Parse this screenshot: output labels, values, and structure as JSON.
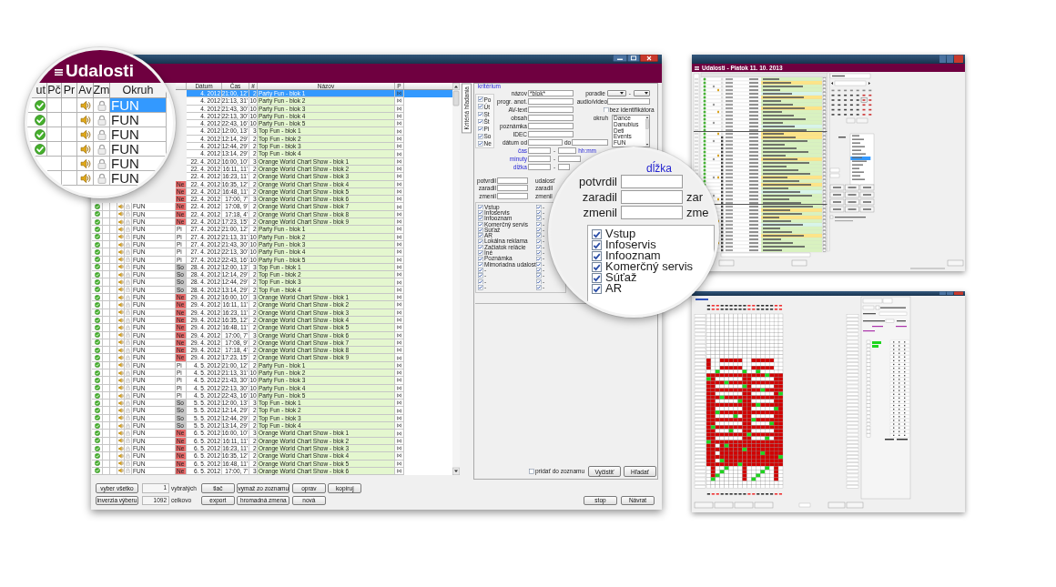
{
  "main_window": {
    "magnifier": {
      "title": "Udalosti",
      "columns": [
        "ut",
        "Pč",
        "Pr",
        "Av",
        "Zm",
        "Okruh"
      ],
      "rows": [
        {
          "selected": true,
          "confirmed": true,
          "audio": true,
          "locked": true,
          "okruh": "FUN"
        },
        {
          "selected": false,
          "confirmed": true,
          "audio": true,
          "locked": true,
          "okruh": "FUN"
        },
        {
          "selected": false,
          "confirmed": true,
          "audio": true,
          "locked": true,
          "okruh": "FUN"
        },
        {
          "selected": false,
          "confirmed": true,
          "audio": true,
          "locked": true,
          "okruh": "FUN"
        },
        {
          "selected": false,
          "audio": true,
          "locked": true,
          "okruh": "FUN"
        },
        {
          "selected": false,
          "audio": true,
          "locked": true,
          "okruh": "FUN"
        }
      ]
    },
    "table": {
      "columns": [
        "Dátum",
        "Čas",
        "#",
        "Názov",
        "P"
      ],
      "rows": [
        {
          "selected": true,
          "date": "4. 2012",
          "time": "21:00, 12'",
          "count": "2",
          "name": "Party Fun - blok 1"
        },
        {
          "selected": false,
          "date": "4. 2012",
          "time": "21:13, 31'",
          "count": "10",
          "name": "Party Fun - blok 2"
        },
        {
          "selected": false,
          "date": "4. 2012",
          "time": "21:43, 30'",
          "count": "10",
          "name": "Party Fun - blok 3"
        },
        {
          "selected": false,
          "date": "4. 2012",
          "time": "22:13, 30'",
          "count": "10",
          "name": "Party Fun - blok 4"
        },
        {
          "selected": false,
          "date": "4. 2012",
          "time": "22:43, 16'",
          "count": "10",
          "name": "Party Fun - blok 5"
        },
        {
          "selected": false,
          "date": "4. 2012",
          "time": "12:00, 13'",
          "count": "3",
          "name": "Top Fun - blok 1"
        },
        {
          "selected": false,
          "date": "4. 2012",
          "time": "12:14, 29'",
          "count": "2",
          "name": "Top Fun - blok 2"
        },
        {
          "selected": false,
          "date": "4. 2012",
          "time": "12:44, 29'",
          "count": "2",
          "name": "Top Fun - blok 3"
        },
        {
          "selected": false,
          "date": "4. 2012",
          "time": "13:14, 29'",
          "count": "2",
          "name": "Top Fun - blok 4"
        },
        {
          "selected": false,
          "date": "22. 4. 2012",
          "time": "16:00, 10'",
          "count": "3",
          "name": "Orange World Chart Show - blok 1"
        },
        {
          "selected": false,
          "date": "22. 4. 2012",
          "time": "16:11, 11'",
          "count": "2",
          "name": "Orange World Chart Show - blok 2"
        },
        {
          "selected": false,
          "date": "22. 4. 2012",
          "time": "16:23, 11'",
          "count": "2",
          "name": "Orange World Chart Show - blok 3"
        },
        {
          "selected": false,
          "day": "Ne",
          "color": "#e86a6a",
          "date": "22. 4. 2012",
          "time": "16:35, 12'",
          "count": "2",
          "name": "Orange World Chart Show - blok 4"
        },
        {
          "selected": false,
          "day": "Ne",
          "color": "#e86a6a",
          "date": "22. 4. 2012",
          "time": "16:48, 11'",
          "count": "2",
          "name": "Orange World Chart Show - blok 5"
        },
        {
          "selected": false,
          "day": "Ne",
          "color": "#e86a6a",
          "date": "22. 4. 2012",
          "time": "17:00, 7'",
          "count": "3",
          "name": "Orange World Chart Show - blok 6"
        },
        {
          "selected": false,
          "confirmed": true,
          "audio": true,
          "locked": true,
          "okruh": "FUN",
          "day": "Ne",
          "color": "#e86a6a",
          "date": "22. 4. 2012",
          "time": "17:08, 9'",
          "count": "2",
          "name": "Orange World Chart Show - blok 7"
        },
        {
          "selected": false,
          "confirmed": true,
          "audio": true,
          "locked": true,
          "okruh": "FUN",
          "day": "Ne",
          "color": "#e86a6a",
          "date": "22. 4. 2012",
          "time": "17:18, 4'",
          "count": "2",
          "name": "Orange World Chart Show - blok 8"
        },
        {
          "selected": false,
          "confirmed": true,
          "audio": true,
          "locked": true,
          "okruh": "FUN",
          "day": "Ne",
          "color": "#e86a6a",
          "date": "22. 4. 2012",
          "time": "17:23, 15'",
          "count": "2",
          "name": "Orange World Chart Show - blok 9"
        },
        {
          "selected": false,
          "confirmed": true,
          "audio": true,
          "locked": true,
          "okruh": "FUN",
          "day": "Pi",
          "date": "27. 4. 2012",
          "time": "21:00, 12'",
          "count": "2",
          "name": "Party Fun - blok 1"
        },
        {
          "selected": false,
          "confirmed": true,
          "audio": true,
          "locked": true,
          "okruh": "FUN",
          "day": "Pi",
          "date": "27. 4. 2012",
          "time": "21:13, 31'",
          "count": "10",
          "name": "Party Fun - blok 2"
        },
        {
          "selected": false,
          "confirmed": true,
          "audio": true,
          "locked": true,
          "okruh": "FUN",
          "day": "Pi",
          "date": "27. 4. 2012",
          "time": "21:43, 30'",
          "count": "10",
          "name": "Party Fun - blok 3"
        },
        {
          "selected": false,
          "confirmed": true,
          "audio": true,
          "locked": true,
          "okruh": "FUN",
          "day": "Pi",
          "date": "27. 4. 2012",
          "time": "22:13, 30'",
          "count": "10",
          "name": "Party Fun - blok 4"
        },
        {
          "selected": false,
          "confirmed": true,
          "audio": true,
          "locked": true,
          "okruh": "FUN",
          "day": "Pi",
          "date": "27. 4. 2012",
          "time": "22:43, 16'",
          "count": "10",
          "name": "Party Fun - blok 5"
        },
        {
          "selected": false,
          "confirmed": true,
          "audio": true,
          "locked": true,
          "okruh": "FUN",
          "day": "So",
          "color": "#c8c8c8",
          "date": "28. 4. 2012",
          "time": "12:00, 13'",
          "count": "3",
          "name": "Top Fun - blok 1"
        },
        {
          "selected": false,
          "confirmed": true,
          "audio": true,
          "locked": true,
          "okruh": "FUN",
          "day": "So",
          "color": "#c8c8c8",
          "date": "28. 4. 2012",
          "time": "12:14, 29'",
          "count": "2",
          "name": "Top Fun - blok 2"
        },
        {
          "selected": false,
          "confirmed": true,
          "audio": true,
          "locked": true,
          "okruh": "FUN",
          "day": "So",
          "color": "#c8c8c8",
          "date": "28. 4. 2012",
          "time": "12:44, 29'",
          "count": "2",
          "name": "Top Fun - blok 3"
        },
        {
          "selected": false,
          "confirmed": true,
          "audio": true,
          "locked": true,
          "okruh": "FUN",
          "day": "So",
          "color": "#c8c8c8",
          "date": "28. 4. 2012",
          "time": "13:14, 29'",
          "count": "2",
          "name": "Top Fun - blok 4"
        },
        {
          "selected": false,
          "confirmed": true,
          "audio": true,
          "locked": true,
          "okruh": "FUN",
          "day": "Ne",
          "color": "#e86a6a",
          "date": "29. 4. 2012",
          "time": "16:00, 10'",
          "count": "3",
          "name": "Orange World Chart Show - blok 1"
        },
        {
          "selected": false,
          "confirmed": true,
          "audio": true,
          "locked": true,
          "okruh": "FUN",
          "day": "Ne",
          "color": "#e86a6a",
          "date": "29. 4. 2012",
          "time": "16:11, 11'",
          "count": "2",
          "name": "Orange World Chart Show - blok 2"
        },
        {
          "selected": false,
          "confirmed": true,
          "audio": true,
          "locked": true,
          "okruh": "FUN",
          "day": "Ne",
          "color": "#e86a6a",
          "date": "29. 4. 2012",
          "time": "16:23, 11'",
          "count": "2",
          "name": "Orange World Chart Show - blok 3"
        },
        {
          "selected": false,
          "confirmed": true,
          "audio": true,
          "locked": true,
          "okruh": "FUN",
          "day": "Ne",
          "color": "#e86a6a",
          "date": "29. 4. 2012",
          "time": "16:35, 12'",
          "count": "2",
          "name": "Orange World Chart Show - blok 4"
        },
        {
          "selected": false,
          "confirmed": true,
          "audio": true,
          "locked": true,
          "okruh": "FUN",
          "day": "Ne",
          "color": "#e86a6a",
          "date": "29. 4. 2012",
          "time": "16:48, 11'",
          "count": "2",
          "name": "Orange World Chart Show - blok 5"
        },
        {
          "selected": false,
          "confirmed": true,
          "audio": true,
          "locked": true,
          "okruh": "FUN",
          "day": "Ne",
          "color": "#e86a6a",
          "date": "29. 4. 2012",
          "time": "17:00, 7'",
          "count": "3",
          "name": "Orange World Chart Show - blok 6"
        },
        {
          "selected": false,
          "confirmed": true,
          "audio": true,
          "locked": true,
          "okruh": "FUN",
          "day": "Ne",
          "color": "#e86a6a",
          "date": "29. 4. 2012",
          "time": "17:08, 9'",
          "count": "2",
          "name": "Orange World Chart Show - blok 7"
        },
        {
          "selected": false,
          "confirmed": true,
          "audio": true,
          "locked": true,
          "okruh": "FUN",
          "day": "Ne",
          "color": "#e86a6a",
          "date": "29. 4. 2012",
          "time": "17:18, 4'",
          "count": "2",
          "name": "Orange World Chart Show - blok 8"
        },
        {
          "selected": false,
          "confirmed": true,
          "audio": true,
          "locked": true,
          "okruh": "FUN",
          "day": "Ne",
          "color": "#e86a6a",
          "date": "29. 4. 2012",
          "time": "17:23, 15'",
          "count": "2",
          "name": "Orange World Chart Show - blok 9"
        },
        {
          "selected": false,
          "confirmed": true,
          "audio": true,
          "locked": true,
          "okruh": "FUN",
          "day": "Pi",
          "date": "4. 5. 2012",
          "time": "21:00, 12'",
          "count": "2",
          "name": "Party Fun - blok 1"
        },
        {
          "selected": false,
          "confirmed": true,
          "audio": true,
          "locked": true,
          "okruh": "FUN",
          "day": "Pi",
          "date": "4. 5. 2012",
          "time": "21:13, 31'",
          "count": "10",
          "name": "Party Fun - blok 2"
        },
        {
          "selected": false,
          "confirmed": true,
          "audio": true,
          "locked": true,
          "okruh": "FUN",
          "day": "Pi",
          "date": "4. 5. 2012",
          "time": "21:43, 30'",
          "count": "10",
          "name": "Party Fun - blok 3"
        },
        {
          "selected": false,
          "confirmed": true,
          "audio": true,
          "locked": true,
          "okruh": "FUN",
          "day": "Pi",
          "date": "4. 5. 2012",
          "time": "22:13, 30'",
          "count": "10",
          "name": "Party Fun - blok 4"
        },
        {
          "selected": false,
          "confirmed": true,
          "audio": true,
          "locked": true,
          "okruh": "FUN",
          "day": "Pi",
          "date": "4. 5. 2012",
          "time": "22:43, 16'",
          "count": "10",
          "name": "Party Fun - blok 5"
        },
        {
          "selected": false,
          "confirmed": true,
          "audio": true,
          "locked": true,
          "okruh": "FUN",
          "day": "So",
          "color": "#c8c8c8",
          "date": "5. 5. 2012",
          "time": "12:00, 13'",
          "count": "3",
          "name": "Top Fun - blok 1"
        },
        {
          "selected": false,
          "confirmed": true,
          "audio": true,
          "locked": true,
          "okruh": "FUN",
          "day": "So",
          "color": "#c8c8c8",
          "date": "5. 5. 2012",
          "time": "12:14, 29'",
          "count": "2",
          "name": "Top Fun - blok 2"
        },
        {
          "selected": false,
          "confirmed": true,
          "audio": true,
          "locked": true,
          "okruh": "FUN",
          "day": "So",
          "color": "#c8c8c8",
          "date": "5. 5. 2012",
          "time": "12:44, 29'",
          "count": "2",
          "name": "Top Fun - blok 3"
        },
        {
          "selected": false,
          "confirmed": true,
          "audio": true,
          "locked": true,
          "okruh": "FUN",
          "day": "So",
          "color": "#c8c8c8",
          "date": "5. 5. 2012",
          "time": "13:14, 29'",
          "count": "2",
          "name": "Top Fun - blok 4"
        },
        {
          "selected": false,
          "confirmed": true,
          "audio": true,
          "locked": true,
          "okruh": "FUN",
          "day": "Ne",
          "color": "#e86a6a",
          "date": "6. 5. 2012",
          "time": "16:00, 10'",
          "count": "3",
          "name": "Orange World Chart Show - blok 1"
        },
        {
          "selected": false,
          "confirmed": true,
          "audio": true,
          "locked": true,
          "okruh": "FUN",
          "day": "Ne",
          "color": "#e86a6a",
          "date": "6. 5. 2012",
          "time": "16:11, 11'",
          "count": "2",
          "name": "Orange World Chart Show - blok 2"
        },
        {
          "selected": false,
          "confirmed": true,
          "audio": true,
          "locked": true,
          "okruh": "FUN",
          "day": "Ne",
          "color": "#e86a6a",
          "date": "6. 5. 2012",
          "time": "16:23, 11'",
          "count": "2",
          "name": "Orange World Chart Show - blok 3"
        },
        {
          "selected": false,
          "confirmed": true,
          "audio": true,
          "locked": true,
          "okruh": "FUN",
          "day": "Ne",
          "color": "#e86a6a",
          "date": "6. 5. 2012",
          "time": "16:35, 12'",
          "count": "2",
          "name": "Orange World Chart Show - blok 4"
        },
        {
          "selected": false,
          "confirmed": true,
          "audio": true,
          "locked": true,
          "okruh": "FUN",
          "day": "Ne",
          "color": "#e86a6a",
          "date": "6. 5. 2012",
          "time": "16:48, 11'",
          "count": "2",
          "name": "Orange World Chart Show - blok 5"
        },
        {
          "selected": false,
          "confirmed": true,
          "audio": true,
          "locked": true,
          "okruh": "FUN",
          "day": "Ne",
          "color": "#e86a6a",
          "date": "6. 5. 2012",
          "time": "17:00, 7'",
          "count": "3",
          "name": "Orange World Chart Show - blok 6"
        }
      ]
    },
    "side_tab": {
      "label": "Kritériá hľadania",
      "selected": true
    },
    "criteria": {
      "title": "kritérium",
      "days": [
        {
          "label": "Po",
          "checked": true
        },
        {
          "label": "Út",
          "checked": true
        },
        {
          "label": "St",
          "checked": true
        },
        {
          "label": "Št",
          "checked": true
        },
        {
          "label": "Pi",
          "checked": true
        },
        {
          "label": "So",
          "checked": true
        },
        {
          "label": "Ne",
          "checked": true
        }
      ],
      "fields": [
        {
          "label": "názov",
          "value": "*blok*"
        },
        {
          "label": "progr. anot."
        },
        {
          "label": "AV-text"
        },
        {
          "label": "obsah"
        },
        {
          "label": "poznámka"
        },
        {
          "label": "IDEC"
        }
      ],
      "date": {
        "label": "dátum od",
        "to_label": "do"
      },
      "ranges": [
        {
          "label": "čas",
          "separator": "-",
          "unit": "hh:mm"
        },
        {
          "label": "minuty",
          "separator": "-"
        },
        {
          "label": "dĺžka",
          "separator": "-"
        }
      ],
      "order": {
        "label": "poradie",
        "separator": "-"
      },
      "audio_video": {
        "label": "audio/video"
      },
      "no_id": {
        "label": "bez identifikátora",
        "checked": false
      },
      "okruh": {
        "label": "okruh",
        "items": [
          "Dance",
          "Danubius",
          "Deti",
          "Events",
          "FUN"
        ]
      },
      "people": [
        {
          "label": "potvrdil",
          "side_label": "udalosť"
        },
        {
          "label": "zaradil",
          "side_label": "zaradil"
        },
        {
          "label": "zmenil",
          "side_label": "zmenil"
        }
      ],
      "types": [
        {
          "label": "Vstup",
          "checked": true
        },
        {
          "label": "Infoservis",
          "checked": true
        },
        {
          "label": "Infooznam",
          "checked": true
        },
        {
          "label": "Komerčný servis",
          "checked": true
        },
        {
          "label": "Súťaž",
          "checked": true
        },
        {
          "label": "AR",
          "checked": true
        },
        {
          "label": "Lokálna reklama",
          "checked": true
        },
        {
          "label": "Začiatok relácie",
          "checked": true
        },
        {
          "label": "Iné",
          "checked": true
        },
        {
          "label": "Poznámka",
          "checked": true
        },
        {
          "label": "Mimoriadna udalosť",
          "checked": true
        },
        {
          "label": "-",
          "checked": true
        },
        {
          "label": "-",
          "checked": true
        },
        {
          "label": "-",
          "checked": true
        },
        {
          "label": "-",
          "checked": true
        }
      ],
      "types_2": [
        {
          "label": "-",
          "checked": true
        },
        {
          "label": "-",
          "checked": true
        },
        {
          "label": "-",
          "checked": true
        },
        {
          "label": "-",
          "checked": true
        },
        {
          "label": "-",
          "checked": true
        },
        {
          "label": "-",
          "checked": true
        },
        {
          "label": "-",
          "checked": true
        },
        {
          "label": "-",
          "checked": true
        },
        {
          "label": "-",
          "checked": true
        },
        {
          "label": "-",
          "checked": true
        },
        {
          "label": "-",
          "checked": true
        },
        {
          "label": "-",
          "checked": true
        },
        {
          "label": "-",
          "checked": true
        },
        {
          "label": "-",
          "checked": true
        },
        {
          "label": "-",
          "checked": true
        }
      ],
      "add_to_list": {
        "label": "pridať do zoznamu",
        "checked": false
      },
      "buttons": [
        "Vyčistiť",
        "Hľadať"
      ]
    },
    "magnifier_detail": {
      "heading": "dĺžka",
      "fields": [
        {
          "label": "potvrdil"
        },
        {
          "label": "zaradil",
          "side_label": "zar"
        },
        {
          "label": "zmenil",
          "side_label": "zme"
        }
      ],
      "types": [
        {
          "label": "Vstup",
          "checked": true
        },
        {
          "label": "Infoservis",
          "checked": true
        },
        {
          "label": "Infooznam",
          "checked": true
        },
        {
          "label": "Komerčný servis",
          "checked": true
        },
        {
          "label": "Súťaž",
          "checked": true
        },
        {
          "label": "AR",
          "checked": true
        }
      ]
    },
    "footer": {
      "select_all": "vyber všetko",
      "invert": "inverzia výberu",
      "counters": [
        {
          "number": "1",
          "caption": "vybratých"
        },
        {
          "number": "1092",
          "caption": "celkovo"
        }
      ],
      "actions": [
        "tlač",
        "vymaž zo zoznamu",
        "oprav",
        "kopíruj",
        "export",
        "hromadná zmena",
        "nová"
      ],
      "nav": [
        "stop",
        "Návrat"
      ]
    }
  },
  "thumbnails": [
    {
      "kind": "event-list",
      "title": "Udalosti - Piatok 11. 10. 2013"
    },
    {
      "kind": "schedule-grid"
    }
  ]
}
